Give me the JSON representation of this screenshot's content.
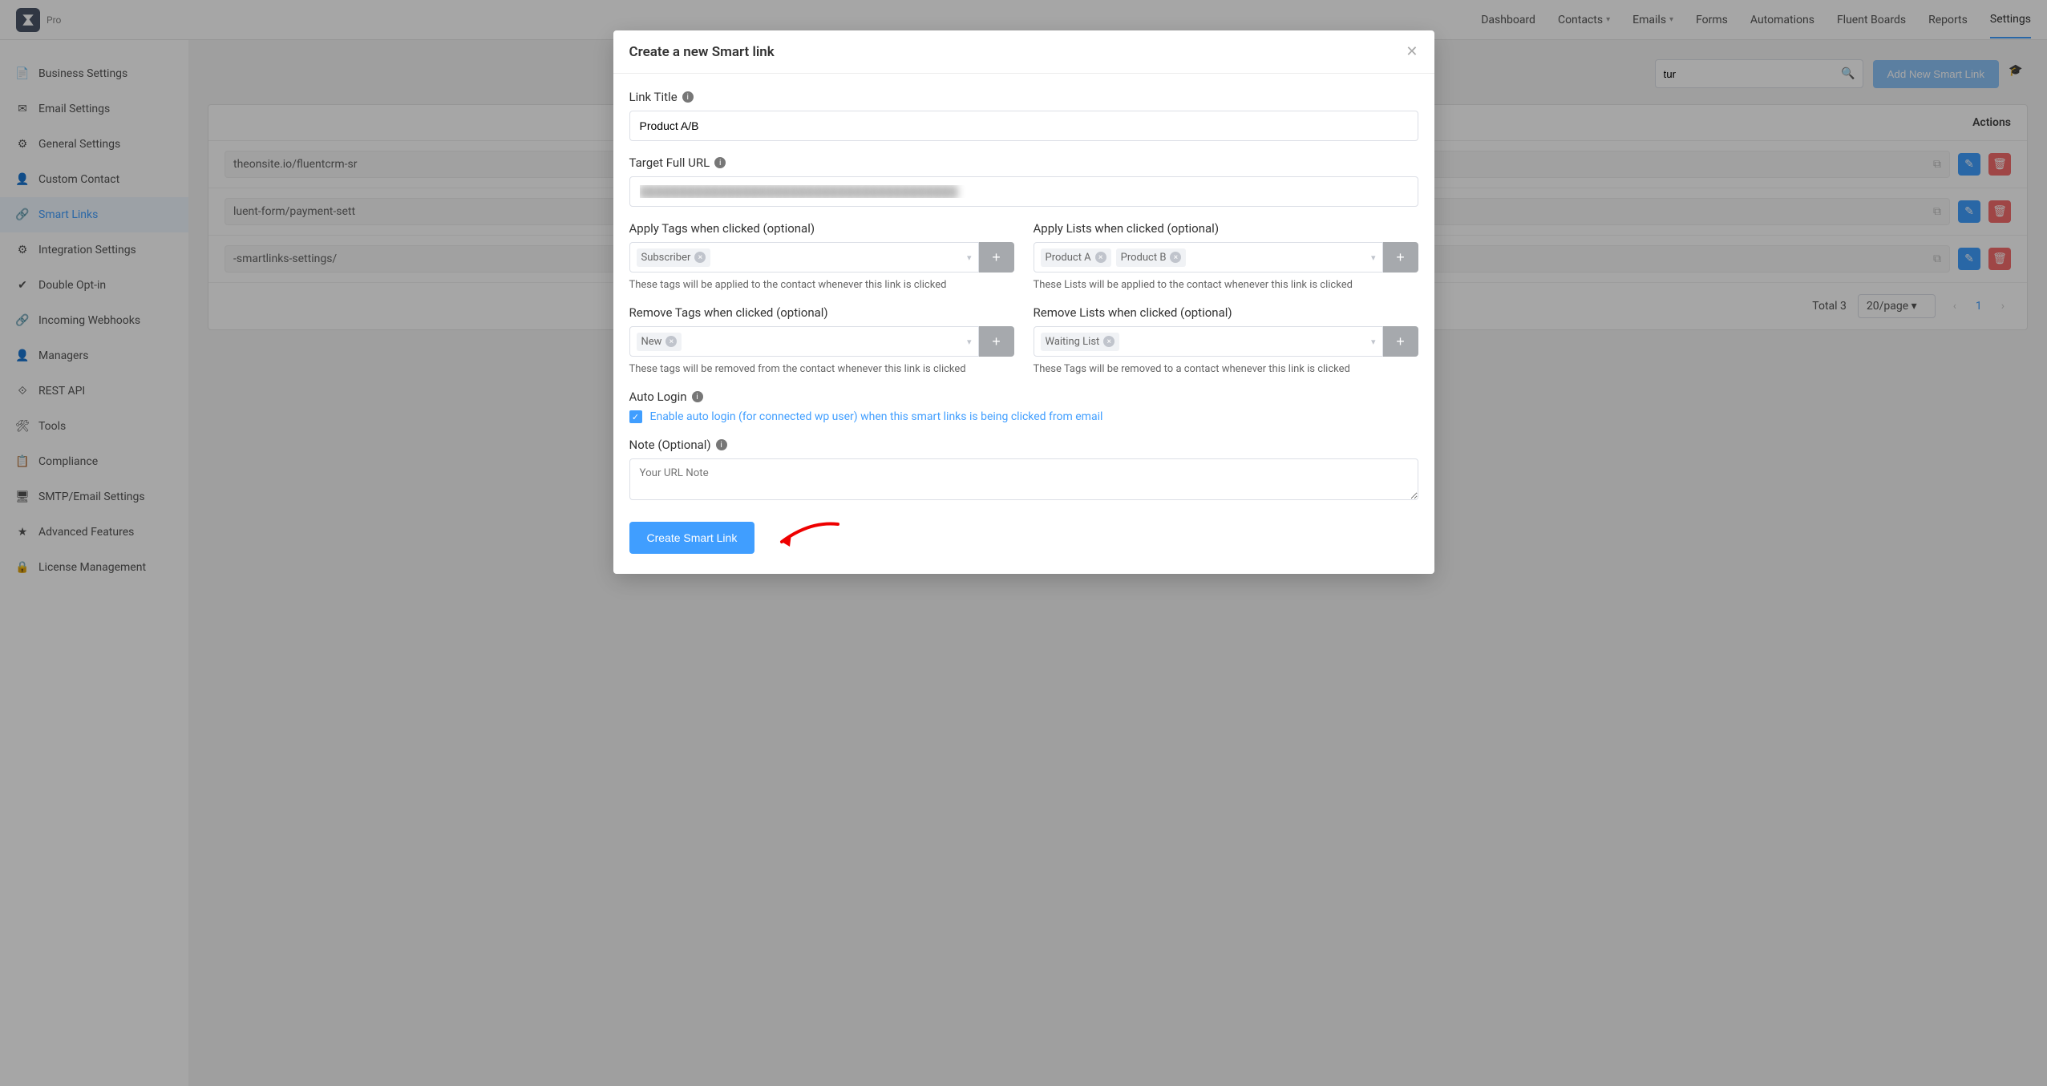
{
  "topnav": {
    "pro": "Pro",
    "items": [
      "Dashboard",
      "Contacts",
      "Emails",
      "Forms",
      "Automations",
      "Fluent Boards",
      "Reports",
      "Settings"
    ]
  },
  "sidebar": {
    "items": [
      {
        "label": "Business Settings"
      },
      {
        "label": "Email Settings"
      },
      {
        "label": "General Settings"
      },
      {
        "label": "Custom Contact"
      },
      {
        "label": "Smart Links",
        "active": true
      },
      {
        "label": "Integration Settings"
      },
      {
        "label": "Double Opt-in"
      },
      {
        "label": "Incoming Webhooks"
      },
      {
        "label": "Managers"
      },
      {
        "label": "REST API"
      },
      {
        "label": "Tools"
      },
      {
        "label": "Compliance"
      },
      {
        "label": "SMTP/Email Settings"
      },
      {
        "label": "Advanced Features"
      },
      {
        "label": "License Management"
      }
    ]
  },
  "page": {
    "search_value": "tur",
    "add_button": "Add New Smart Link",
    "actions_header": "Actions",
    "rows": [
      {
        "url": "theonsite.io/fluentcrm-sr"
      },
      {
        "url": "luent-form/payment-sett"
      },
      {
        "url": "-smartlinks-settings/"
      }
    ],
    "total": "Total 3",
    "page_size": "20/page",
    "current_page": "1"
  },
  "modal": {
    "title": "Create a new Smart link",
    "link_title_label": "Link Title",
    "link_title_value": "Product A/B",
    "target_url_label": "Target Full URL",
    "target_url_value": "",
    "apply_tags_label": "Apply Tags when clicked (optional)",
    "apply_tags_hint": "These tags will be applied to the contact whenever this link is clicked",
    "apply_tags": [
      "Subscriber"
    ],
    "apply_lists_label": "Apply Lists when clicked (optional)",
    "apply_lists_hint": "These Lists will be applied to the contact whenever this link is clicked",
    "apply_lists": [
      "Product A",
      "Product B"
    ],
    "remove_tags_label": "Remove Tags when clicked (optional)",
    "remove_tags_hint": "These tags will be removed from the contact whenever this link is clicked",
    "remove_tags": [
      "New"
    ],
    "remove_lists_label": "Remove Lists when clicked (optional)",
    "remove_lists_hint": "These Tags will be removed to a contact whenever this link is clicked",
    "remove_lists": [
      "Waiting List"
    ],
    "auto_login_label": "Auto Login",
    "auto_login_check": "Enable auto login (for connected wp user) when this smart links is being clicked from email",
    "note_label": "Note (Optional)",
    "note_placeholder": "Your URL Note",
    "submit": "Create Smart Link"
  }
}
